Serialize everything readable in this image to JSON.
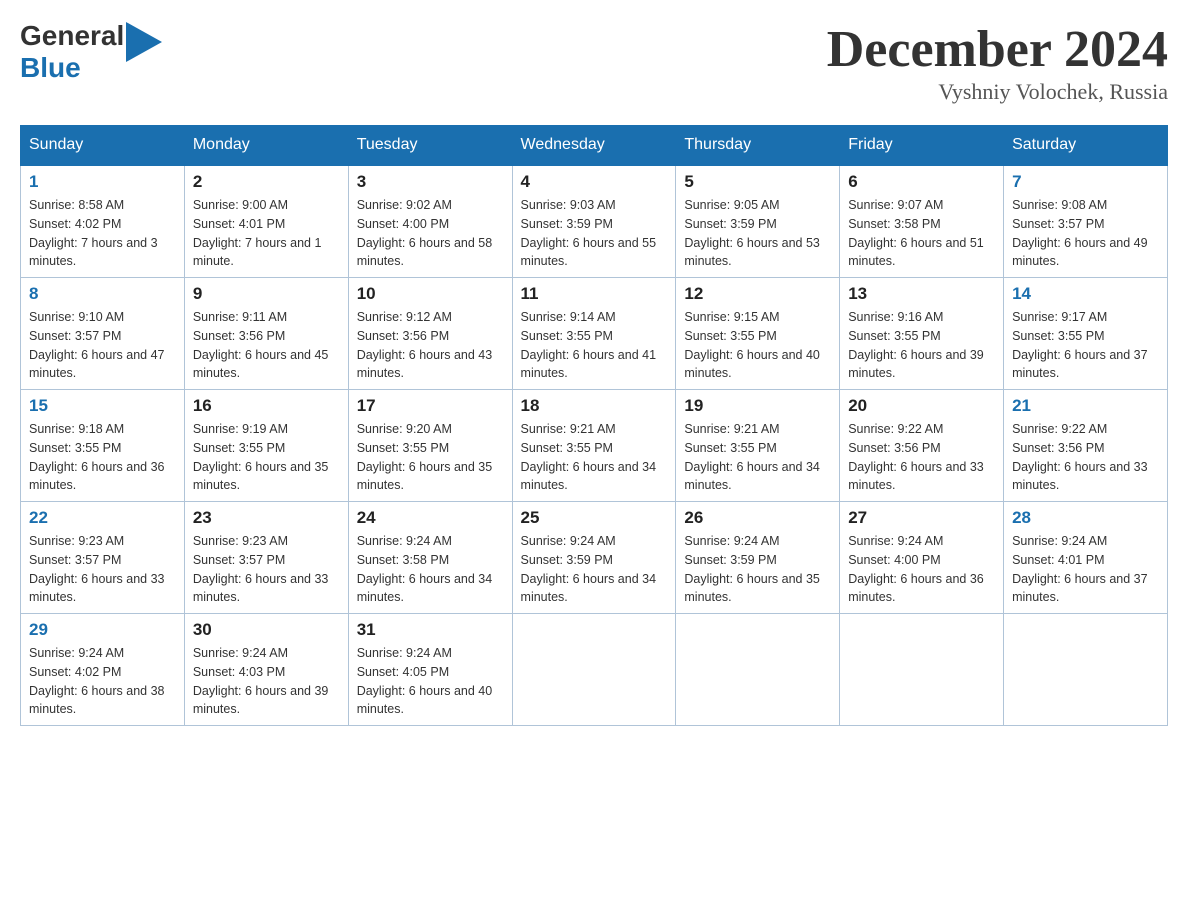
{
  "header": {
    "logo": {
      "text_general": "General",
      "text_blue": "Blue"
    },
    "title": "December 2024",
    "location": "Vyshniy Volochek, Russia"
  },
  "days_of_week": [
    "Sunday",
    "Monday",
    "Tuesday",
    "Wednesday",
    "Thursday",
    "Friday",
    "Saturday"
  ],
  "weeks": [
    [
      {
        "day": "1",
        "sunrise": "8:58 AM",
        "sunset": "4:02 PM",
        "daylight": "7 hours and 3 minutes."
      },
      {
        "day": "2",
        "sunrise": "9:00 AM",
        "sunset": "4:01 PM",
        "daylight": "7 hours and 1 minute."
      },
      {
        "day": "3",
        "sunrise": "9:02 AM",
        "sunset": "4:00 PM",
        "daylight": "6 hours and 58 minutes."
      },
      {
        "day": "4",
        "sunrise": "9:03 AM",
        "sunset": "3:59 PM",
        "daylight": "6 hours and 55 minutes."
      },
      {
        "day": "5",
        "sunrise": "9:05 AM",
        "sunset": "3:59 PM",
        "daylight": "6 hours and 53 minutes."
      },
      {
        "day": "6",
        "sunrise": "9:07 AM",
        "sunset": "3:58 PM",
        "daylight": "6 hours and 51 minutes."
      },
      {
        "day": "7",
        "sunrise": "9:08 AM",
        "sunset": "3:57 PM",
        "daylight": "6 hours and 49 minutes."
      }
    ],
    [
      {
        "day": "8",
        "sunrise": "9:10 AM",
        "sunset": "3:57 PM",
        "daylight": "6 hours and 47 minutes."
      },
      {
        "day": "9",
        "sunrise": "9:11 AM",
        "sunset": "3:56 PM",
        "daylight": "6 hours and 45 minutes."
      },
      {
        "day": "10",
        "sunrise": "9:12 AM",
        "sunset": "3:56 PM",
        "daylight": "6 hours and 43 minutes."
      },
      {
        "day": "11",
        "sunrise": "9:14 AM",
        "sunset": "3:55 PM",
        "daylight": "6 hours and 41 minutes."
      },
      {
        "day": "12",
        "sunrise": "9:15 AM",
        "sunset": "3:55 PM",
        "daylight": "6 hours and 40 minutes."
      },
      {
        "day": "13",
        "sunrise": "9:16 AM",
        "sunset": "3:55 PM",
        "daylight": "6 hours and 39 minutes."
      },
      {
        "day": "14",
        "sunrise": "9:17 AM",
        "sunset": "3:55 PM",
        "daylight": "6 hours and 37 minutes."
      }
    ],
    [
      {
        "day": "15",
        "sunrise": "9:18 AM",
        "sunset": "3:55 PM",
        "daylight": "6 hours and 36 minutes."
      },
      {
        "day": "16",
        "sunrise": "9:19 AM",
        "sunset": "3:55 PM",
        "daylight": "6 hours and 35 minutes."
      },
      {
        "day": "17",
        "sunrise": "9:20 AM",
        "sunset": "3:55 PM",
        "daylight": "6 hours and 35 minutes."
      },
      {
        "day": "18",
        "sunrise": "9:21 AM",
        "sunset": "3:55 PM",
        "daylight": "6 hours and 34 minutes."
      },
      {
        "day": "19",
        "sunrise": "9:21 AM",
        "sunset": "3:55 PM",
        "daylight": "6 hours and 34 minutes."
      },
      {
        "day": "20",
        "sunrise": "9:22 AM",
        "sunset": "3:56 PM",
        "daylight": "6 hours and 33 minutes."
      },
      {
        "day": "21",
        "sunrise": "9:22 AM",
        "sunset": "3:56 PM",
        "daylight": "6 hours and 33 minutes."
      }
    ],
    [
      {
        "day": "22",
        "sunrise": "9:23 AM",
        "sunset": "3:57 PM",
        "daylight": "6 hours and 33 minutes."
      },
      {
        "day": "23",
        "sunrise": "9:23 AM",
        "sunset": "3:57 PM",
        "daylight": "6 hours and 33 minutes."
      },
      {
        "day": "24",
        "sunrise": "9:24 AM",
        "sunset": "3:58 PM",
        "daylight": "6 hours and 34 minutes."
      },
      {
        "day": "25",
        "sunrise": "9:24 AM",
        "sunset": "3:59 PM",
        "daylight": "6 hours and 34 minutes."
      },
      {
        "day": "26",
        "sunrise": "9:24 AM",
        "sunset": "3:59 PM",
        "daylight": "6 hours and 35 minutes."
      },
      {
        "day": "27",
        "sunrise": "9:24 AM",
        "sunset": "4:00 PM",
        "daylight": "6 hours and 36 minutes."
      },
      {
        "day": "28",
        "sunrise": "9:24 AM",
        "sunset": "4:01 PM",
        "daylight": "6 hours and 37 minutes."
      }
    ],
    [
      {
        "day": "29",
        "sunrise": "9:24 AM",
        "sunset": "4:02 PM",
        "daylight": "6 hours and 38 minutes."
      },
      {
        "day": "30",
        "sunrise": "9:24 AM",
        "sunset": "4:03 PM",
        "daylight": "6 hours and 39 minutes."
      },
      {
        "day": "31",
        "sunrise": "9:24 AM",
        "sunset": "4:05 PM",
        "daylight": "6 hours and 40 minutes."
      },
      null,
      null,
      null,
      null
    ]
  ]
}
